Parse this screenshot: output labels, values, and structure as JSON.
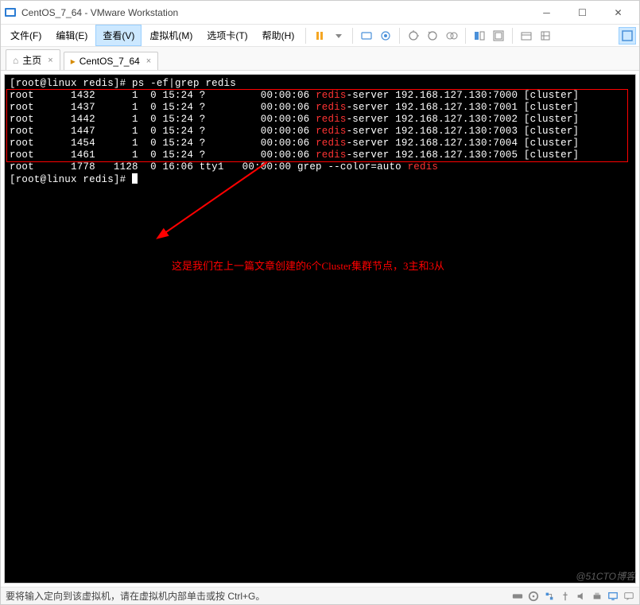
{
  "window": {
    "title": "CentOS_7_64 - VMware Workstation"
  },
  "menu": {
    "file": "文件(F)",
    "edit": "编辑(E)",
    "view": "查看(V)",
    "vm": "虚拟机(M)",
    "tabs": "选项卡(T)",
    "help": "帮助(H)"
  },
  "tabs": {
    "home": "主页",
    "vm": "CentOS_7_64"
  },
  "terminal": {
    "prompt1": "[root@linux redis]#",
    "cmd1": " ps -ef|grep redis",
    "rows": [
      {
        "user": "root",
        "pid": "1432",
        "ppid": "1",
        "c": "0",
        "stime": "15:24",
        "tty": "?",
        "time": "00:00:06",
        "cmd_pre": "",
        "redis": "redis",
        "cmd_post": "-server 192.168.127.130:7000 [cluster]"
      },
      {
        "user": "root",
        "pid": "1437",
        "ppid": "1",
        "c": "0",
        "stime": "15:24",
        "tty": "?",
        "time": "00:00:06",
        "cmd_pre": "",
        "redis": "redis",
        "cmd_post": "-server 192.168.127.130:7001 [cluster]"
      },
      {
        "user": "root",
        "pid": "1442",
        "ppid": "1",
        "c": "0",
        "stime": "15:24",
        "tty": "?",
        "time": "00:00:06",
        "cmd_pre": "",
        "redis": "redis",
        "cmd_post": "-server 192.168.127.130:7002 [cluster]"
      },
      {
        "user": "root",
        "pid": "1447",
        "ppid": "1",
        "c": "0",
        "stime": "15:24",
        "tty": "?",
        "time": "00:00:06",
        "cmd_pre": "",
        "redis": "redis",
        "cmd_post": "-server 192.168.127.130:7003 [cluster]"
      },
      {
        "user": "root",
        "pid": "1454",
        "ppid": "1",
        "c": "0",
        "stime": "15:24",
        "tty": "?",
        "time": "00:00:06",
        "cmd_pre": "",
        "redis": "redis",
        "cmd_post": "-server 192.168.127.130:7004 [cluster]"
      },
      {
        "user": "root",
        "pid": "1461",
        "ppid": "1",
        "c": "0",
        "stime": "15:24",
        "tty": "?",
        "time": "00:00:06",
        "cmd_pre": "",
        "redis": "redis",
        "cmd_post": "-server 192.168.127.130:7005 [cluster]"
      }
    ],
    "grep_row": {
      "user": "root",
      "pid": "1778",
      "ppid": "1128",
      "c": "0",
      "stime": "16:06",
      "tty": "tty1",
      "time": "00:00:00",
      "cmd_pre": "grep --color=auto ",
      "redis": "redis",
      "cmd_post": ""
    },
    "prompt2": "[root@linux redis]# "
  },
  "annotation": {
    "text": "这是我们在上一篇文章创建的6个Cluster集群节点，3主和3从"
  },
  "statusbar": {
    "msg": "要将输入定向到该虚拟机，请在虚拟机内部单击或按 Ctrl+G。"
  },
  "watermark": "@51CTO博客",
  "colors": {
    "highlight": "#ff3333",
    "box": "#ff0000"
  }
}
